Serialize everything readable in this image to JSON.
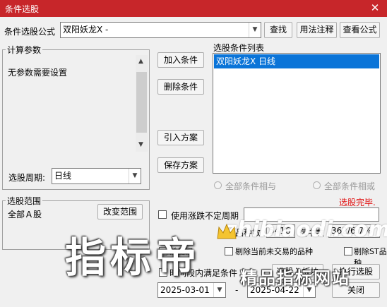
{
  "window": {
    "title": "条件选股",
    "close_glyph": "✕"
  },
  "formula": {
    "label": "条件选股公式",
    "value": "双阳妖龙X  -",
    "find_label": "查找",
    "usage_label": "用法注释",
    "view_label": "查看公式"
  },
  "params": {
    "group_title": "计算参数",
    "text": "无参数需要设置",
    "period_label": "选股周期:",
    "period_value": "日线"
  },
  "actions": {
    "add_label": "加入条件",
    "delete_label": "删除条件",
    "import_label": "引入方案",
    "save_label": "保存方案"
  },
  "conditions": {
    "title": "选股条件列表",
    "items": [
      "双阳妖龙X  日线"
    ],
    "radio_and": "全部条件相与",
    "radio_or": "全部条件相或"
  },
  "status": {
    "done": "选股完毕."
  },
  "scope": {
    "group_title": "选股范围",
    "value": "全部Ａ股",
    "change_label": "改变范围"
  },
  "options": {
    "use_period_label": "使用涨跌不定周期",
    "count_label": "品种数",
    "count_value": "5416",
    "selected_label": "选中数",
    "selected_value": "362/6.7%",
    "check_a": "前复权",
    "check_b": "剔除当前未交易的品种",
    "check_c": "剔除ST品种",
    "time_label": "时间段内满足条件",
    "start_date": "2025-03-01",
    "dash": "-",
    "end_date": "2025-04-22",
    "to_board_label": "选股入板块",
    "execute_label": "执行选股",
    "close_label": "关闭"
  },
  "watermark": {
    "big": "指标帝",
    "mid": "精品指标网站",
    "url": "zhibiaodi.com"
  },
  "colors": {
    "title_bar": "#c7262a",
    "selection": "#0a74d8",
    "status_red": "#e01010"
  }
}
